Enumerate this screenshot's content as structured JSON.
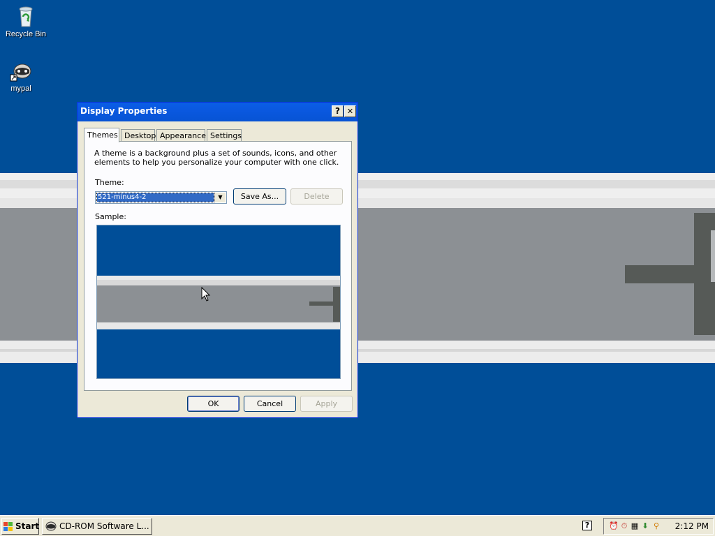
{
  "desktop": {
    "icons": [
      {
        "label": "Recycle Bin",
        "icon": "recycle-bin-icon"
      },
      {
        "label": "mypal",
        "icon": "raccoon-shortcut-icon"
      }
    ]
  },
  "dialog": {
    "title": "Display Properties",
    "help_button": "?",
    "close_button": "✕",
    "tabs": [
      {
        "label": "Themes",
        "active": true
      },
      {
        "label": "Desktop",
        "active": false
      },
      {
        "label": "Appearance",
        "active": false
      },
      {
        "label": "Settings",
        "active": false
      }
    ],
    "description": "A theme is a background plus a set of sounds, icons, and other elements to help you personalize your computer with one click.",
    "theme_label": "Theme:",
    "theme_value": "521-minus4-2",
    "save_as": "Save As...",
    "delete": "Delete",
    "sample_label": "Sample:",
    "ok": "OK",
    "cancel": "Cancel",
    "apply": "Apply"
  },
  "taskbar": {
    "start": "Start",
    "task": "CD-ROM Software L...",
    "clock": "2:12 PM",
    "help_tray": "?"
  },
  "colors": {
    "desktop_blue": "#004e98",
    "title_blue": "#0a58e0",
    "dialog_face": "#ece9d8"
  }
}
